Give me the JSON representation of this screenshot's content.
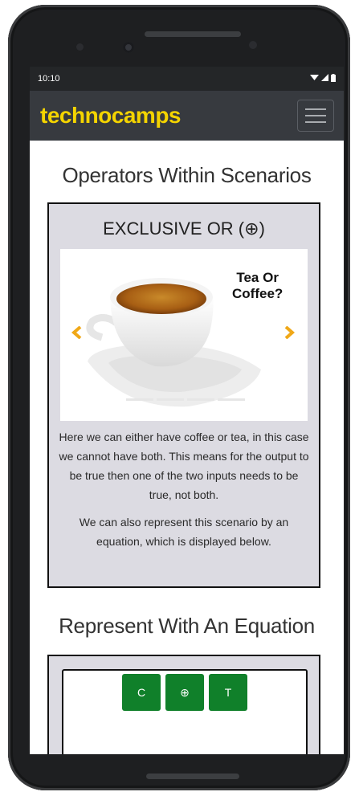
{
  "status": {
    "time": "10:10"
  },
  "header": {
    "logo": "technocamps"
  },
  "main": {
    "heading": "Operators Within Scenarios",
    "card": {
      "title": "EXCLUSIVE OR (⊕)",
      "image_caption": [
        "Tea Or",
        "Coffee?"
      ],
      "paragraph1": "Here we can either have coffee or tea, in this case we cannot have both. This means for the output to be true then one of the two inputs needs to be true, not both.",
      "paragraph2": "We can also represent this scenario by an equation, which is displayed below."
    },
    "heading2": "Represent With An Equation",
    "equation": {
      "buttons": [
        "C",
        "⊕",
        "T"
      ]
    }
  },
  "colors": {
    "accent": "#f4d400",
    "appbar": "#373a3f",
    "button_green": "#10802a",
    "arrow": "#f0a818"
  }
}
